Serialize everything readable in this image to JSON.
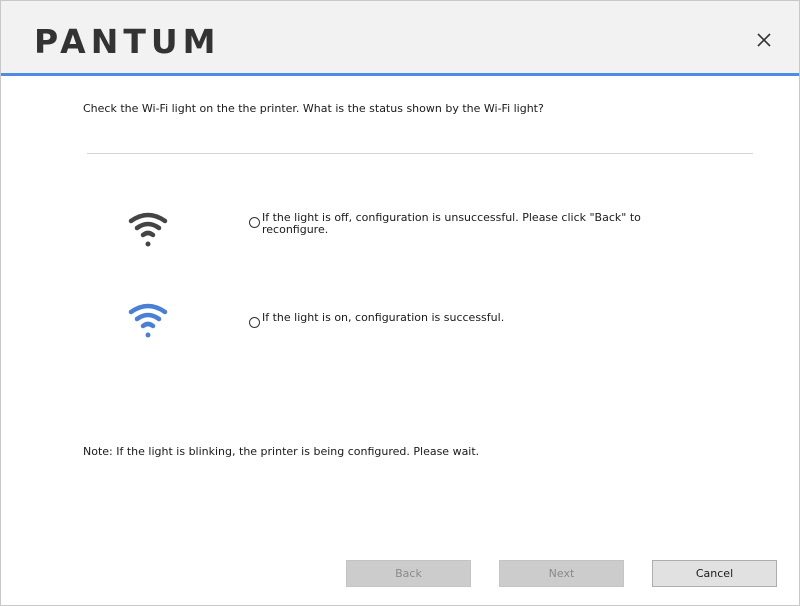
{
  "header": {
    "brand": "PANTUM",
    "close_symbol": "×"
  },
  "main": {
    "question": "Check the Wi-Fi light on the the printer. What is the status shown by the Wi-Fi light?",
    "options": [
      {
        "icon": "wifi-off-icon",
        "icon_color": "#444444",
        "label": "If the light is off, configuration is unsuccessful. Please click \"Back\" to reconfigure.",
        "selected": false
      },
      {
        "icon": "wifi-on-icon",
        "icon_color": "#4a7fd6",
        "label": "If the light is on, configuration is successful.",
        "selected": false
      }
    ],
    "note": "Note:  If the light is blinking, the printer is being configured.  Please wait."
  },
  "buttons": {
    "back": "Back",
    "next": "Next",
    "cancel": "Cancel"
  },
  "colors": {
    "header_bg": "#f2f2f2",
    "accent_line": "#4f8be5",
    "logo": "#333333"
  }
}
